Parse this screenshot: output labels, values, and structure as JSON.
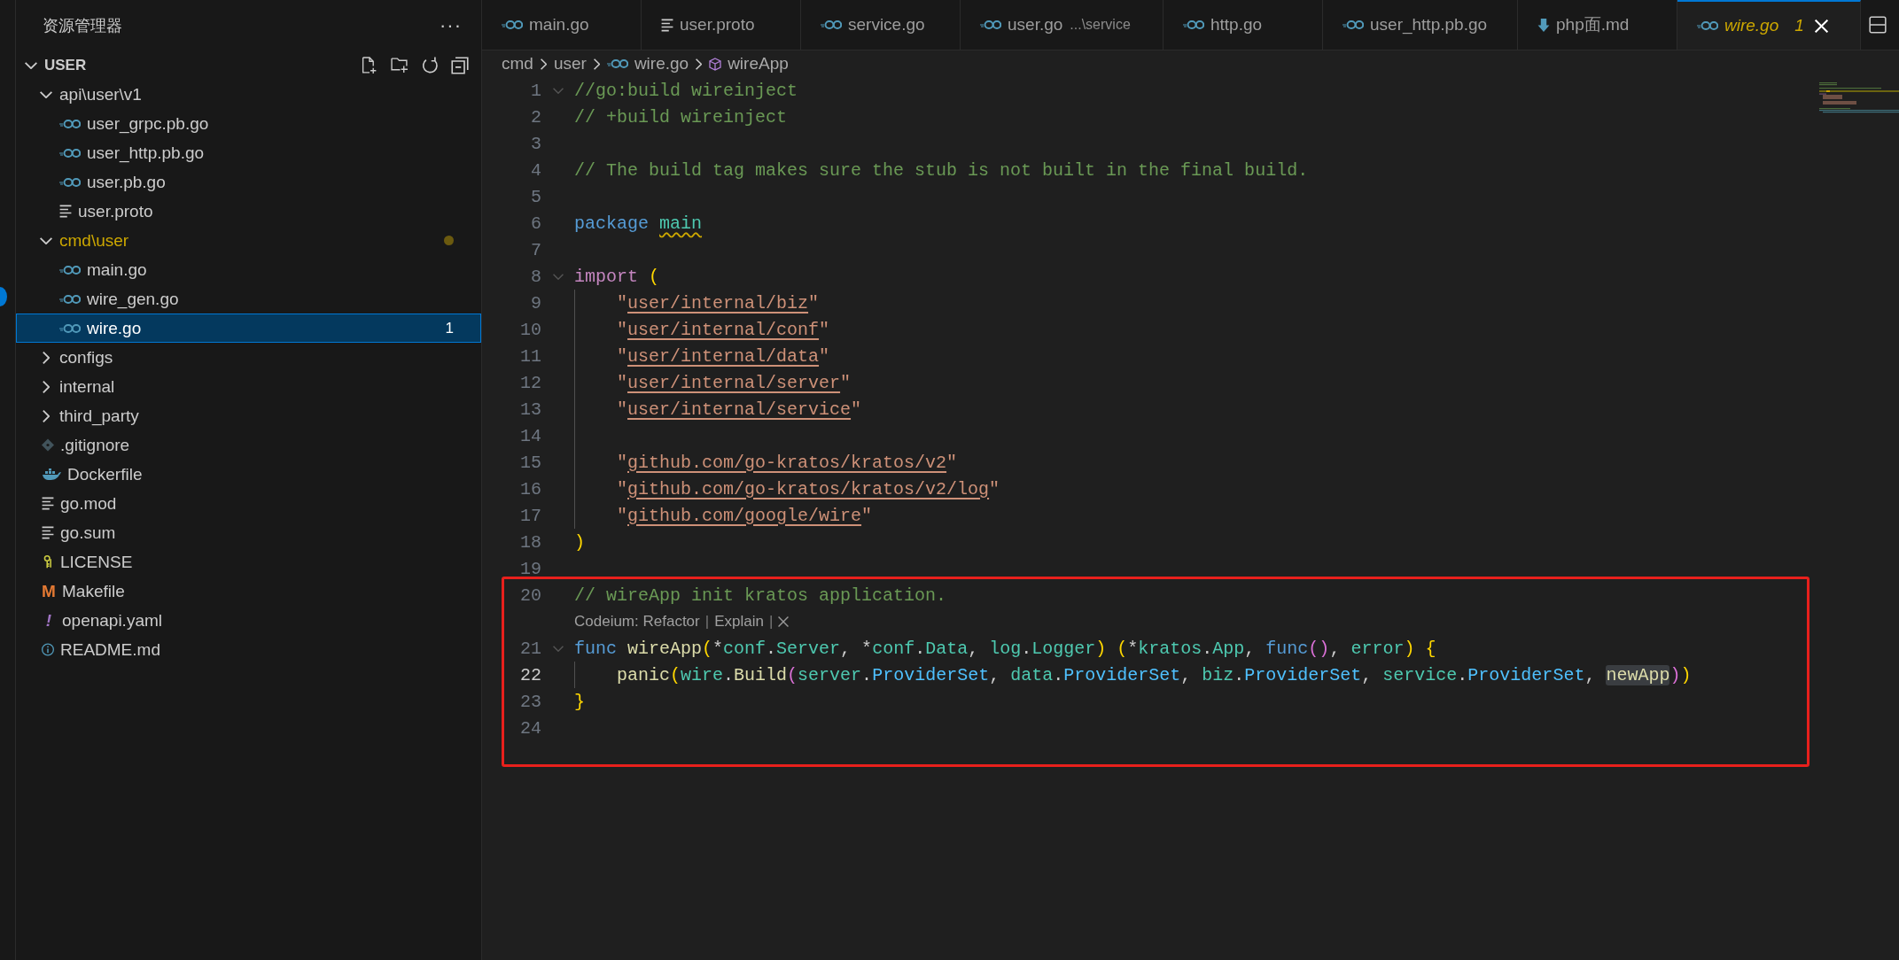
{
  "explorer": {
    "title": "资源管理器",
    "more": "···",
    "section": {
      "label": "USER",
      "expanded": true
    },
    "tree": [
      {
        "label": "api\\user\\v1",
        "kind": "folder",
        "expanded": true,
        "selected": false,
        "warning": false,
        "children": [
          {
            "label": "user_grpc.pb.go",
            "kind": "go",
            "selected": false
          },
          {
            "label": "user_http.pb.go",
            "kind": "go",
            "selected": false
          },
          {
            "label": "user.pb.go",
            "kind": "go",
            "selected": false
          },
          {
            "label": "user.proto",
            "kind": "text",
            "selected": false
          }
        ]
      },
      {
        "label": "cmd\\user",
        "kind": "folder",
        "expanded": true,
        "selected": false,
        "warning": true,
        "children": [
          {
            "label": "main.go",
            "kind": "go",
            "selected": false
          },
          {
            "label": "wire_gen.go",
            "kind": "go",
            "selected": false
          },
          {
            "label": "wire.go",
            "kind": "go",
            "selected": true,
            "badge": "1"
          }
        ]
      },
      {
        "label": "configs",
        "kind": "folder",
        "expanded": false,
        "selected": false,
        "warning": false
      },
      {
        "label": "internal",
        "kind": "folder",
        "expanded": false,
        "selected": false,
        "warning": false
      },
      {
        "label": "third_party",
        "kind": "folder",
        "expanded": false,
        "selected": false,
        "warning": false
      },
      {
        "label": ".gitignore",
        "kind": "git",
        "selected": false
      },
      {
        "label": "Dockerfile",
        "kind": "docker",
        "selected": false
      },
      {
        "label": "go.mod",
        "kind": "text",
        "selected": false
      },
      {
        "label": "go.sum",
        "kind": "text",
        "selected": false
      },
      {
        "label": "LICENSE",
        "kind": "key",
        "selected": false
      },
      {
        "label": "Makefile",
        "kind": "makefile",
        "glyph": "M",
        "selected": false
      },
      {
        "label": "openapi.yaml",
        "kind": "yaml",
        "glyph": "!",
        "selected": false
      },
      {
        "label": "README.md",
        "kind": "info",
        "selected": false
      }
    ]
  },
  "tabs": [
    {
      "label": "main.go",
      "kind": "go",
      "selected": false,
      "preview": false,
      "warning": false
    },
    {
      "label": "user.proto",
      "kind": "text",
      "selected": false,
      "preview": false,
      "warning": false
    },
    {
      "label": "service.go",
      "kind": "go",
      "selected": false,
      "preview": false,
      "warning": false
    },
    {
      "label": "user.go",
      "description": "...\\service",
      "kind": "go",
      "selected": false,
      "preview": false,
      "warning": false
    },
    {
      "label": "http.go",
      "kind": "go",
      "selected": false,
      "preview": false,
      "warning": false
    },
    {
      "label": "user_http.pb.go",
      "kind": "go",
      "selected": false,
      "preview": false,
      "warning": false
    },
    {
      "label": "php面.md",
      "kind": "markdown",
      "selected": false,
      "preview": false,
      "warning": false
    },
    {
      "label": "wire.go",
      "kind": "go",
      "selected": true,
      "preview": true,
      "warning": true,
      "count": "1"
    }
  ],
  "breadcrumb": [
    {
      "label": "cmd",
      "kind": "segment"
    },
    {
      "label": "user",
      "kind": "segment"
    },
    {
      "label": "wire.go",
      "kind": "go"
    },
    {
      "label": "wireApp",
      "kind": "symbol"
    }
  ],
  "editor": {
    "lines": [
      {
        "kind": "code",
        "number": "1",
        "current": false,
        "foldable": true,
        "guide": false,
        "tokens": [
          {
            "text": "//go:build wireinject",
            "kind": "c"
          }
        ]
      },
      {
        "kind": "code",
        "number": "2",
        "current": false,
        "foldable": false,
        "guide": false,
        "tokens": [
          {
            "text": "// +build wireinject",
            "kind": "c"
          }
        ]
      },
      {
        "kind": "code",
        "number": "3",
        "current": false,
        "foldable": false,
        "guide": false
      },
      {
        "kind": "code",
        "number": "4",
        "current": false,
        "foldable": false,
        "guide": false,
        "tokens": [
          {
            "text": "// The build tag makes sure the stub is not built in the final build.",
            "kind": "c"
          }
        ]
      },
      {
        "kind": "code",
        "number": "5",
        "current": false,
        "foldable": false,
        "guide": false
      },
      {
        "kind": "code",
        "number": "6",
        "current": false,
        "foldable": false,
        "guide": false,
        "tokens": [
          {
            "text": "package ",
            "kind": "kw"
          },
          {
            "text": "main",
            "kind": "warn"
          }
        ]
      },
      {
        "kind": "code",
        "number": "7",
        "current": false,
        "foldable": false,
        "guide": false
      },
      {
        "kind": "code",
        "number": "8",
        "current": false,
        "foldable": true,
        "guide": false,
        "tokens": [
          {
            "text": "import ",
            "kind": "imp"
          },
          {
            "text": "(",
            "kind": "b1"
          }
        ]
      },
      {
        "kind": "code",
        "number": "9",
        "current": false,
        "foldable": false,
        "guide": true,
        "tokens": [
          {
            "text": "\"",
            "kind": "s"
          },
          {
            "text": "user/internal/biz",
            "kind": "link"
          },
          {
            "text": "\"",
            "kind": "s"
          }
        ]
      },
      {
        "kind": "code",
        "number": "10",
        "current": false,
        "foldable": false,
        "guide": true,
        "tokens": [
          {
            "text": "\"",
            "kind": "s"
          },
          {
            "text": "user/internal/conf",
            "kind": "link"
          },
          {
            "text": "\"",
            "kind": "s"
          }
        ]
      },
      {
        "kind": "code",
        "number": "11",
        "current": false,
        "foldable": false,
        "guide": true,
        "tokens": [
          {
            "text": "\"",
            "kind": "s"
          },
          {
            "text": "user/internal/data",
            "kind": "link"
          },
          {
            "text": "\"",
            "kind": "s"
          }
        ]
      },
      {
        "kind": "code",
        "number": "12",
        "current": false,
        "foldable": false,
        "guide": true,
        "tokens": [
          {
            "text": "\"",
            "kind": "s"
          },
          {
            "text": "user/internal/server",
            "kind": "link"
          },
          {
            "text": "\"",
            "kind": "s"
          }
        ]
      },
      {
        "kind": "code",
        "number": "13",
        "current": false,
        "foldable": false,
        "guide": true,
        "tokens": [
          {
            "text": "\"",
            "kind": "s"
          },
          {
            "text": "user/internal/service",
            "kind": "link"
          },
          {
            "text": "\"",
            "kind": "s"
          }
        ]
      },
      {
        "kind": "code",
        "number": "14",
        "current": false,
        "foldable": false,
        "guide": true
      },
      {
        "kind": "code",
        "number": "15",
        "current": false,
        "foldable": false,
        "guide": true,
        "tokens": [
          {
            "text": "\"",
            "kind": "s"
          },
          {
            "text": "github.com/go-kratos/kratos/v2",
            "kind": "link"
          },
          {
            "text": "\"",
            "kind": "s"
          }
        ]
      },
      {
        "kind": "code",
        "number": "16",
        "current": false,
        "foldable": false,
        "guide": true,
        "tokens": [
          {
            "text": "\"",
            "kind": "s"
          },
          {
            "text": "github.com/go-kratos/kratos/v2/log",
            "kind": "link"
          },
          {
            "text": "\"",
            "kind": "s"
          }
        ]
      },
      {
        "kind": "code",
        "number": "17",
        "current": false,
        "foldable": false,
        "guide": true,
        "tokens": [
          {
            "text": "\"",
            "kind": "s"
          },
          {
            "text": "github.com/google/wire",
            "kind": "link"
          },
          {
            "text": "\"",
            "kind": "s"
          }
        ]
      },
      {
        "kind": "code",
        "number": "18",
        "current": false,
        "foldable": false,
        "guide": false,
        "tokens": [
          {
            "text": ")",
            "kind": "b1"
          }
        ]
      },
      {
        "kind": "code",
        "number": "19",
        "current": false,
        "foldable": false,
        "guide": false
      },
      {
        "kind": "code",
        "number": "20",
        "current": false,
        "foldable": false,
        "guide": false,
        "tokens": [
          {
            "text": "// wireApp init kratos application.",
            "kind": "c"
          }
        ]
      },
      {
        "kind": "lens",
        "parts": [
          {
            "text": "Codeium: Refactor",
            "kind": "action"
          },
          {
            "text": "|",
            "kind": "sep"
          },
          {
            "text": "Explain",
            "kind": "action"
          },
          {
            "text": "|",
            "kind": "sep"
          }
        ],
        "close": true
      },
      {
        "kind": "code",
        "number": "21",
        "current": false,
        "foldable": true,
        "guide": false,
        "tokens": [
          {
            "text": "func ",
            "kind": "kw"
          },
          {
            "text": "wireApp",
            "kind": "fn"
          },
          {
            "text": "(",
            "kind": "b1"
          },
          {
            "text": "*",
            "kind": "p"
          },
          {
            "text": "conf",
            "kind": "ty"
          },
          {
            "text": ".",
            "kind": "p"
          },
          {
            "text": "Server",
            "kind": "ty"
          },
          {
            "text": ", *",
            "kind": "p"
          },
          {
            "text": "conf",
            "kind": "ty"
          },
          {
            "text": ".",
            "kind": "p"
          },
          {
            "text": "Data",
            "kind": "ty"
          },
          {
            "text": ", ",
            "kind": "p"
          },
          {
            "text": "log",
            "kind": "ty"
          },
          {
            "text": ".",
            "kind": "p"
          },
          {
            "text": "Logger",
            "kind": "ty"
          },
          {
            "text": ")",
            "kind": "b1"
          },
          {
            "text": " (",
            "kind": "b1"
          },
          {
            "text": "*",
            "kind": "p"
          },
          {
            "text": "kratos",
            "kind": "ty"
          },
          {
            "text": ".",
            "kind": "p"
          },
          {
            "text": "App",
            "kind": "ty"
          },
          {
            "text": ", ",
            "kind": "p"
          },
          {
            "text": "func",
            "kind": "kw"
          },
          {
            "text": "()",
            "kind": "b2"
          },
          {
            "text": ", ",
            "kind": "p"
          },
          {
            "text": "error",
            "kind": "ty"
          },
          {
            "text": ")",
            "kind": "b1"
          },
          {
            "text": " {",
            "kind": "b1"
          }
        ]
      },
      {
        "kind": "code",
        "number": "22",
        "current": true,
        "foldable": false,
        "guide": true,
        "tokens": [
          {
            "text": "panic",
            "kind": "fn"
          },
          {
            "text": "(",
            "kind": "b1"
          },
          {
            "text": "wire",
            "kind": "ty"
          },
          {
            "text": ".",
            "kind": "p"
          },
          {
            "text": "Build",
            "kind": "fn"
          },
          {
            "text": "(",
            "kind": "b2"
          },
          {
            "text": "server",
            "kind": "ty"
          },
          {
            "text": ".",
            "kind": "p"
          },
          {
            "text": "ProviderSet",
            "kind": "var"
          },
          {
            "text": ", ",
            "kind": "p"
          },
          {
            "text": "data",
            "kind": "ty"
          },
          {
            "text": ".",
            "kind": "p"
          },
          {
            "text": "ProviderSet",
            "kind": "var"
          },
          {
            "text": ", ",
            "kind": "p"
          },
          {
            "text": "biz",
            "kind": "ty"
          },
          {
            "text": ".",
            "kind": "p"
          },
          {
            "text": "ProviderSet",
            "kind": "var"
          },
          {
            "text": ", ",
            "kind": "p"
          },
          {
            "text": "service",
            "kind": "ty"
          },
          {
            "text": ".",
            "kind": "p"
          },
          {
            "text": "ProviderSet",
            "kind": "var"
          },
          {
            "text": ", ",
            "kind": "p"
          },
          {
            "text": "newApp",
            "kind": "hl"
          },
          {
            "text": ")",
            "kind": "b2"
          },
          {
            "text": ")",
            "kind": "b1"
          }
        ]
      },
      {
        "kind": "code",
        "number": "23",
        "current": false,
        "foldable": false,
        "guide": false,
        "tokens": [
          {
            "text": "}",
            "kind": "b1"
          }
        ]
      },
      {
        "kind": "code",
        "number": "24",
        "current": false,
        "foldable": false,
        "guide": false
      }
    ]
  }
}
